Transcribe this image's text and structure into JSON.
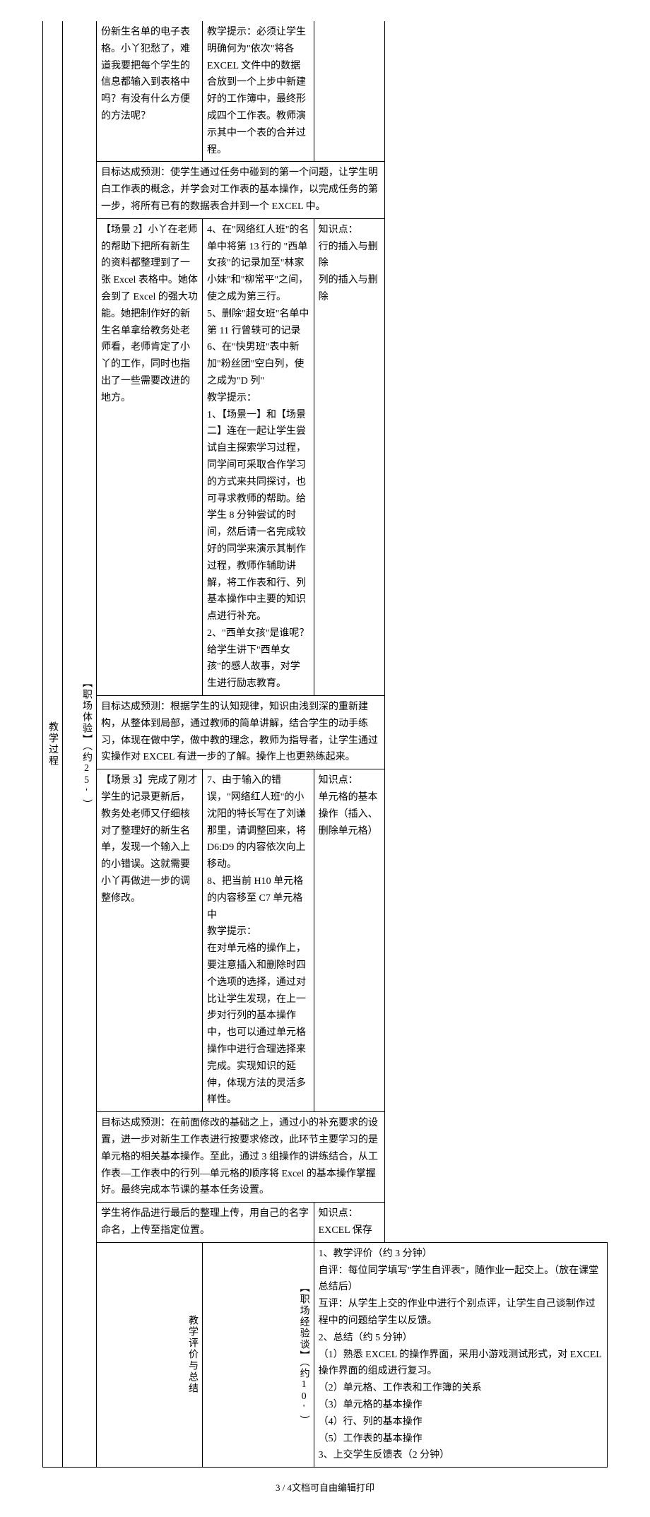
{
  "section1": {
    "vlabel_main": "教学过程",
    "vlabel_sub": "【职场体验】（约25'）",
    "row1": {
      "scene": "份新生名单的电子表格。小丫犯愁了，难道我要把每个学生的信息都输入到表格中吗？有没有什么方便的方法呢？",
      "tip": "教学提示：必须让学生明确何为\"依次\"将各 EXCEL 文件中的数据合放到一个上步中新建好的工作簿中，最终形成四个工作表。教师演示其中一个表的合并过程。"
    },
    "goal1": "目标达成预测：使学生通过任务中碰到的第一个问题，让学生明白工作表的概念，并学会对工作表的基本操作，以完成任务的第一步，将所有已有的数据表合并到一个 EXCEL 中。",
    "row2": {
      "scene": "【场景 2】小丫在老师的帮助下把所有新生的资料都整理到了一张 Excel 表格中。她体会到了 Excel 的强大功能。她把制作好的新生名单拿给教务处老师看，老师肯定了小丫的工作，同时也指出了一些需要改进的地方。",
      "tip": "4、在\"网络红人班\"的名单中将第 13 行的 \"西单女孩\"的记录加至\"林家小妹\"和\"柳常平\"之间，使之成为第三行。\n5、删除\"超女班\"名单中第 11 行曾轶可的记录\n6、在\"快男班\"表中新加\"粉丝团\"空白列，使之成为\"D 列\"\n教学提示：\n1、【场景一】和【场景二】连在一起让学生尝试自主探索学习过程，同学间可采取合作学习的方式来共同探讨，也可寻求教师的帮助。给学生 8 分钟尝试的时间，然后请一名完成较好的同学来演示其制作过程，教师作辅助讲解，将工作表和行、列基本操作中主要的知识点进行补充。\n2、\"西单女孩\"是谁呢？给学生讲下\"西单女孩\"的感人故事，对学生进行励志教育。",
      "knowledge": "知识点：\n行的插入与删除\n列的插入与删除"
    },
    "goal2": "目标达成预测：根据学生的认知规律，知识由浅到深的重新建构，从整体到局部，通过教师的简单讲解，结合学生的动手练习，体现在做中学，做中教的理念，教师为指导者，让学生通过实操作对 EXCEL 有进一步的了解。操作上也更熟练起来。",
    "row3": {
      "scene": "【场景 3】完成了刚才学生的记录更新后，教务处老师又仔细核对了整理好的新生名单，发现一个输入上的小错误。这就需要小丫再做进一步的调整修改。",
      "tip": "7、由于输入的错误，\"网络红人班\"的小沈阳的特长写在了刘谦那里，请调整回来，将 D6:D9 的内容依次向上移动。\n8、把当前 H10 单元格的内容移至 C7 单元格中\n教学提示：\n在对单元格的操作上，要注意插入和删除时四个选项的选择，通过对比让学生发现，在上一步对行列的基本操作中，也可以通过单元格操作中进行合理选择来完成。实现知识的延伸，体现方法的灵活多样性。",
      "knowledge": "知识点：\n单元格的基本操作（插入、删除单元格）"
    },
    "goal3": "目标达成预测：在前面修改的基础之上，通过小的补充要求的设置，进一步对新生工作表进行按要求修改，此环节主要学习的是单元格的相关基本操作。至此，通过 3 组操作的讲练结合，从工作表—工作表中的行列—单元格的顺序将 Excel 的基本操作掌握好。最终完成本节课的基本任务设置。",
    "row4": {
      "upload": "学生将作品进行最后的整理上传，用自己的名字命名，上传至指定位置。",
      "knowledge": "知识点：\nEXCEL 保存"
    }
  },
  "section2": {
    "vlabel_main": "教学评价与总结",
    "vlabel_sub": "【职场经验谈】（约10'）",
    "content": "1、教学评价（约 3 分钟）\n自评：每位同学填写\"学生自评表\"，随作业一起交上。（放在课堂总结后）\n互评：从学生上交的作业中进行个别点评，让学生自己谈制作过程中的问题给学生以反馈。\n2、总结（约 5 分钟）\n（1）熟悉 EXCEL 的操作界面，采用小游戏测试形式，对 EXCEL 操作界面的组成进行复习。\n（2）单元格、工作表和工作簿的关系\n（3）单元格的基本操作\n（4）行、列的基本操作\n（5）工作表的基本操作\n3、上交学生反馈表（2 分钟）"
  },
  "footer": "3 / 4文档可自由编辑打印"
}
